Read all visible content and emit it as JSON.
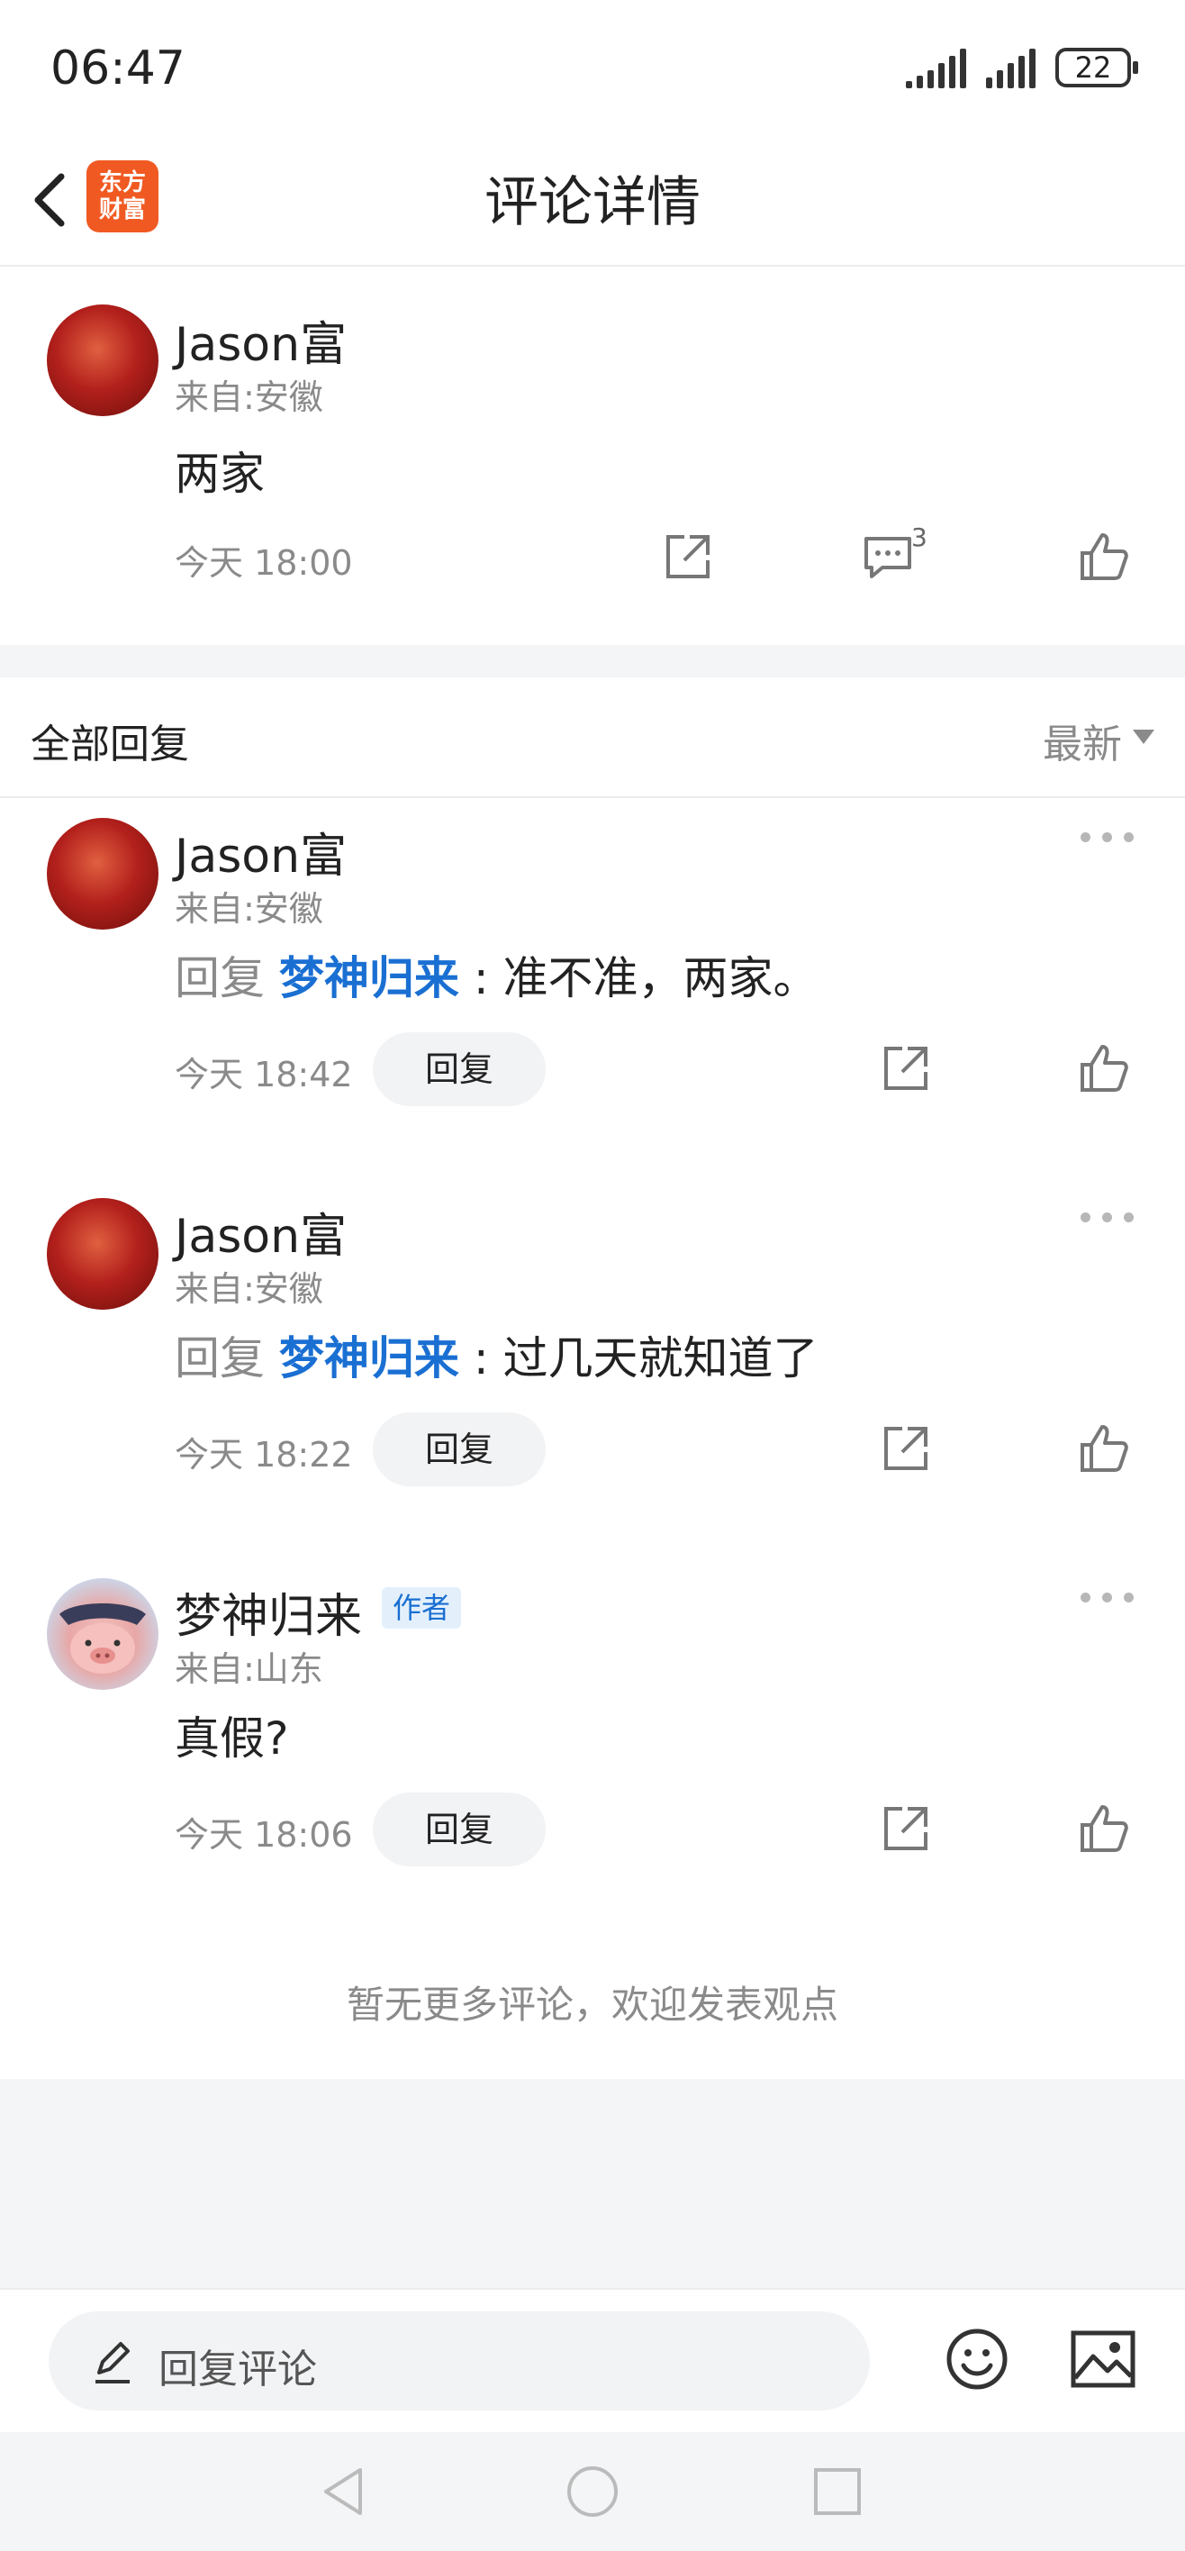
{
  "status_bar": {
    "time": "06:47",
    "battery": "22"
  },
  "header": {
    "title": "评论详情",
    "app_logo_line1": "东方",
    "app_logo_line2": "财富"
  },
  "main_comment": {
    "username": "Jason富",
    "location": "来自:安徽",
    "text": "两家",
    "time": "今天 18:00",
    "comment_count": "3"
  },
  "replies_section": {
    "title": "全部回复",
    "sort_label": "最新",
    "reply_button_label": "回复",
    "reply_prefix": "回复",
    "items": [
      {
        "username": "Jason富",
        "location": "来自:安徽",
        "reply_to": "梦神归来",
        "text": ": 准不准，两家。",
        "time": "今天 18:42"
      },
      {
        "username": "Jason富",
        "location": "来自:安徽",
        "reply_to": "梦神归来",
        "text": ": 过几天就知道了",
        "time": "今天 18:22"
      },
      {
        "username": "梦神归来",
        "author_tag": "作者",
        "location": "来自:山东",
        "text": "真假?",
        "time": "今天 18:06"
      }
    ],
    "no_more": "暂无更多评论，欢迎发表观点"
  },
  "bottom_bar": {
    "input_placeholder": "回复评论"
  },
  "icons": {
    "back": "chevron-left-icon",
    "share": "share-icon",
    "comment": "comment-icon",
    "like": "thumbs-up-icon",
    "more": "more-dots-icon",
    "edit": "pencil-icon",
    "emoji": "emoji-icon",
    "image": "image-icon"
  },
  "colors": {
    "link_blue": "#1a6fd2",
    "brand_orange": "#f05a22"
  }
}
